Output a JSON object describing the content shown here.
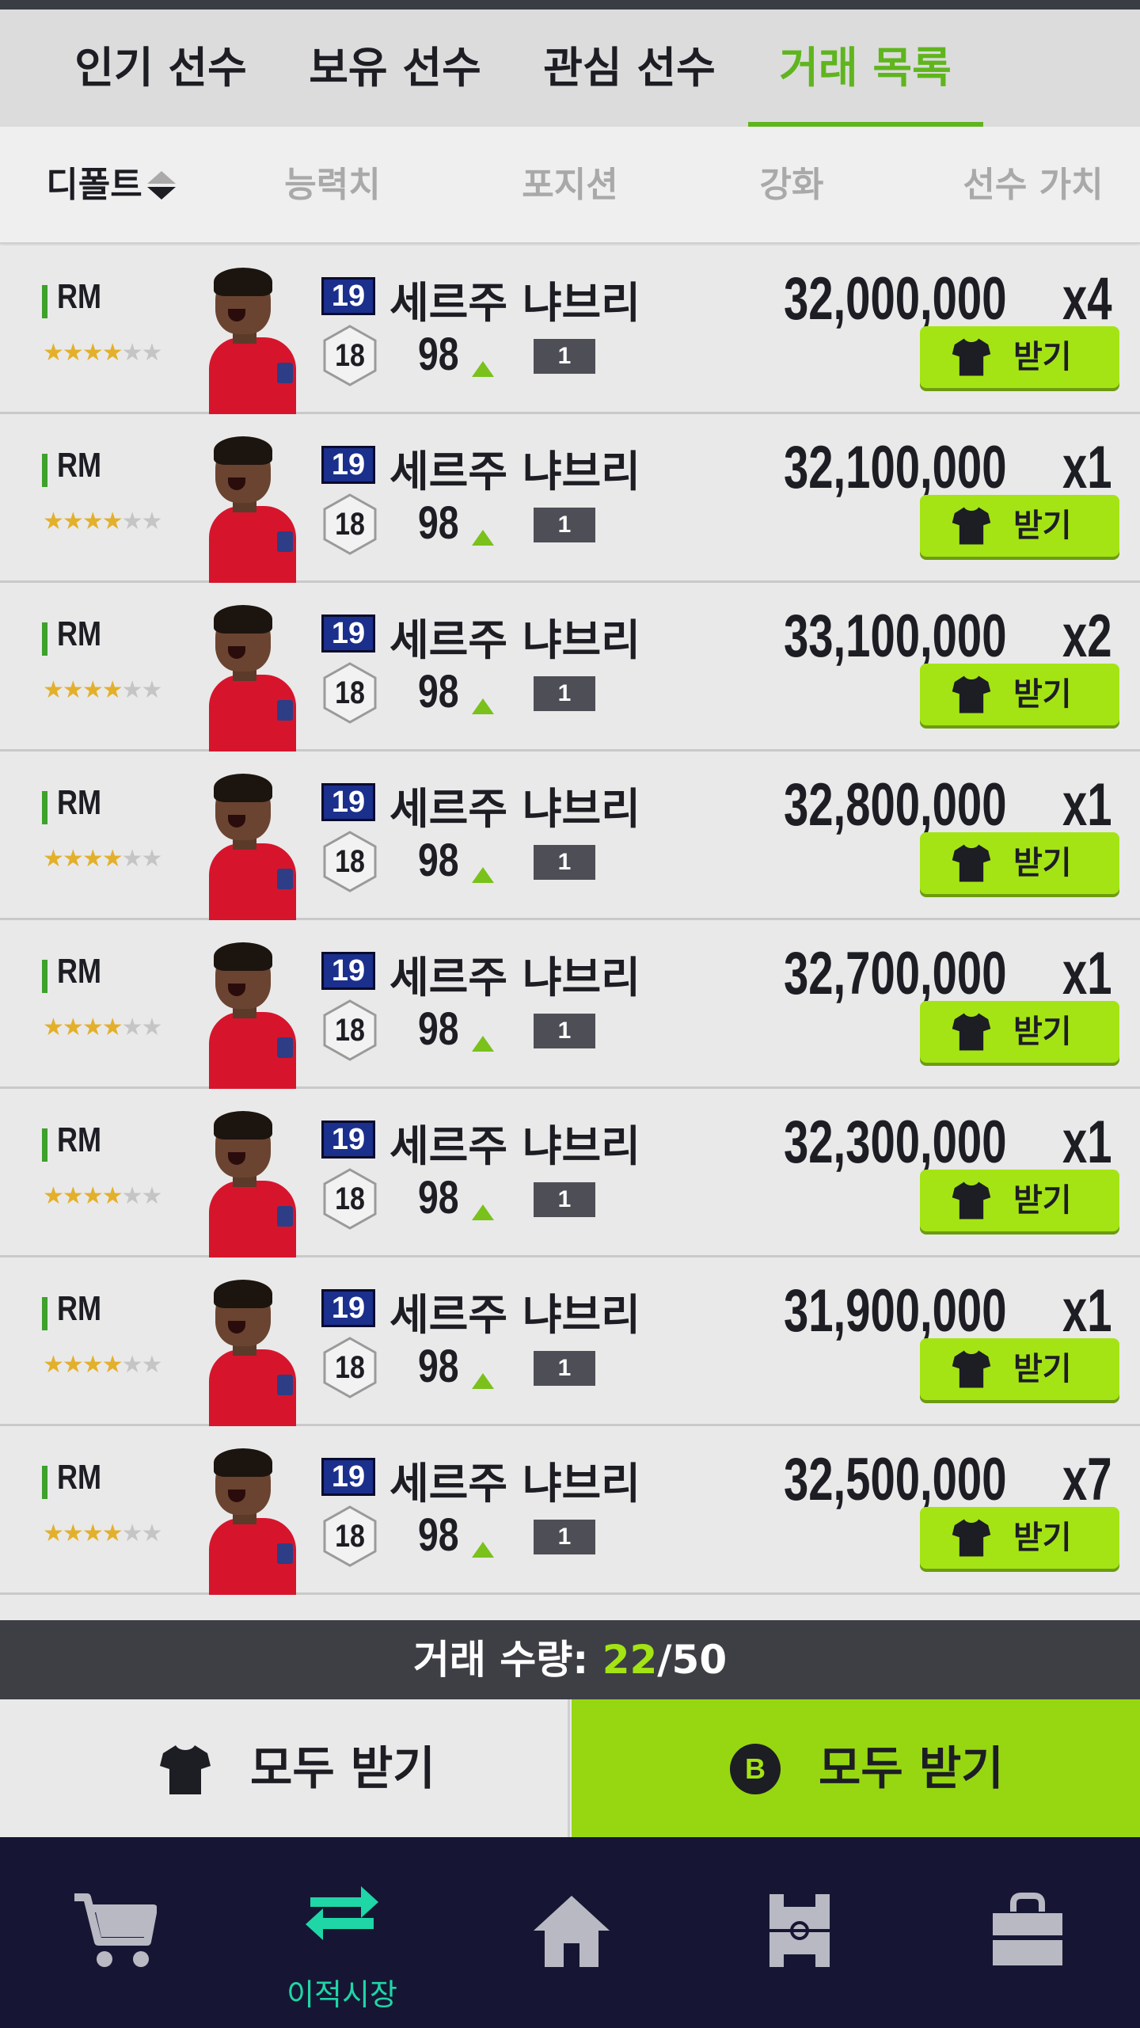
{
  "tabs": [
    {
      "label": "인기 선수"
    },
    {
      "label": "보유 선수"
    },
    {
      "label": "관심 선수"
    },
    {
      "label": "거래 목록"
    }
  ],
  "active_tab": "거래 목록",
  "sort": {
    "items": [
      "디폴트",
      "능력치",
      "포지션",
      "강화",
      "선수 가치"
    ],
    "active": "디폴트"
  },
  "trades": [
    {
      "position": "RM",
      "stars": 4,
      "season": "19",
      "grade": "18",
      "name": "세르주 냐브리",
      "ovr": "98",
      "enhance": "1",
      "price": "32,000,000",
      "qty": "x4",
      "receive_label": "받기"
    },
    {
      "position": "RM",
      "stars": 4,
      "season": "19",
      "grade": "18",
      "name": "세르주 냐브리",
      "ovr": "98",
      "enhance": "1",
      "price": "32,100,000",
      "qty": "x1",
      "receive_label": "받기"
    },
    {
      "position": "RM",
      "stars": 4,
      "season": "19",
      "grade": "18",
      "name": "세르주 냐브리",
      "ovr": "98",
      "enhance": "1",
      "price": "33,100,000",
      "qty": "x2",
      "receive_label": "받기"
    },
    {
      "position": "RM",
      "stars": 4,
      "season": "19",
      "grade": "18",
      "name": "세르주 냐브리",
      "ovr": "98",
      "enhance": "1",
      "price": "32,800,000",
      "qty": "x1",
      "receive_label": "받기"
    },
    {
      "position": "RM",
      "stars": 4,
      "season": "19",
      "grade": "18",
      "name": "세르주 냐브리",
      "ovr": "98",
      "enhance": "1",
      "price": "32,700,000",
      "qty": "x1",
      "receive_label": "받기"
    },
    {
      "position": "RM",
      "stars": 4,
      "season": "19",
      "grade": "18",
      "name": "세르주 냐브리",
      "ovr": "98",
      "enhance": "1",
      "price": "32,300,000",
      "qty": "x1",
      "receive_label": "받기"
    },
    {
      "position": "RM",
      "stars": 4,
      "season": "19",
      "grade": "18",
      "name": "세르주 냐브리",
      "ovr": "98",
      "enhance": "1",
      "price": "31,900,000",
      "qty": "x1",
      "receive_label": "받기"
    },
    {
      "position": "RM",
      "stars": 4,
      "season": "19",
      "grade": "18",
      "name": "세르주 냐브리",
      "ovr": "98",
      "enhance": "1",
      "price": "32,500,000",
      "qty": "x7",
      "receive_label": "받기"
    }
  ],
  "trade_count": {
    "label": "거래 수량: ",
    "current": "22",
    "max": "/50"
  },
  "receive_all": {
    "shirt_label": "모두 받기",
    "bp_label": "모두 받기",
    "bp_symbol": "B"
  },
  "bottom_nav": [
    {
      "icon": "cart-icon",
      "label": ""
    },
    {
      "icon": "transfer-icon",
      "label": "이적시장"
    },
    {
      "icon": "home-icon",
      "label": ""
    },
    {
      "icon": "pitch-icon",
      "label": ""
    },
    {
      "icon": "store-icon",
      "label": ""
    }
  ],
  "colors": {
    "accent": "#5fb51d",
    "button": "#a4e414",
    "nav_bg": "#161634",
    "nav_active": "#1fd6a6"
  }
}
